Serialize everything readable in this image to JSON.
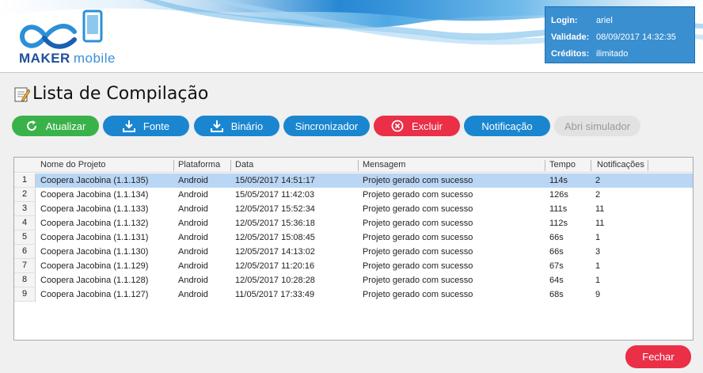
{
  "header": {
    "logo_maker": "MAKER",
    "logo_mobile": "mobile",
    "info": [
      {
        "key": "Login:",
        "value": "ariel"
      },
      {
        "key": "Validade:",
        "value": "08/09/2017 14:32:35"
      },
      {
        "key": "Créditos:",
        "value": "ilimitado"
      }
    ]
  },
  "page": {
    "title": "Lista de Compilação"
  },
  "toolbar": {
    "atualizar": "Atualizar",
    "fonte": "Fonte",
    "binario": "Binário",
    "sincronizador": "Sincronizador",
    "excluir": "Excluir",
    "notificacao": "Notificação",
    "abri_simulador": "Abri simulador"
  },
  "table": {
    "columns": [
      "Nome do Projeto",
      "Plataforma",
      "Data",
      "Mensagem",
      "Tempo",
      "Notificações"
    ],
    "rows": [
      {
        "n": "1",
        "nome": "Coopera Jacobina (1.1.135)",
        "plataforma": "Android",
        "data": "15/05/2017 14:51:17",
        "mensagem": "Projeto gerado com sucesso",
        "tempo": "114s",
        "notif": "2"
      },
      {
        "n": "2",
        "nome": "Coopera Jacobina (1.1.134)",
        "plataforma": "Android",
        "data": "15/05/2017 11:42:03",
        "mensagem": "Projeto gerado com sucesso",
        "tempo": "126s",
        "notif": "2"
      },
      {
        "n": "3",
        "nome": "Coopera Jacobina (1.1.133)",
        "plataforma": "Android",
        "data": "12/05/2017 15:52:34",
        "mensagem": "Projeto gerado com sucesso",
        "tempo": "111s",
        "notif": "11"
      },
      {
        "n": "4",
        "nome": "Coopera Jacobina (1.1.132)",
        "plataforma": "Android",
        "data": "12/05/2017 15:36:18",
        "mensagem": "Projeto gerado com sucesso",
        "tempo": "112s",
        "notif": "11"
      },
      {
        "n": "5",
        "nome": "Coopera Jacobina (1.1.131)",
        "plataforma": "Android",
        "data": "12/05/2017 15:08:45",
        "mensagem": "Projeto gerado com sucesso",
        "tempo": "66s",
        "notif": "1"
      },
      {
        "n": "6",
        "nome": "Coopera Jacobina (1.1.130)",
        "plataforma": "Android",
        "data": "12/05/2017 14:13:02",
        "mensagem": "Projeto gerado com sucesso",
        "tempo": "66s",
        "notif": "3"
      },
      {
        "n": "7",
        "nome": "Coopera Jacobina (1.1.129)",
        "plataforma": "Android",
        "data": "12/05/2017 11:20:16",
        "mensagem": "Projeto gerado com sucesso",
        "tempo": "67s",
        "notif": "1"
      },
      {
        "n": "8",
        "nome": "Coopera Jacobina (1.1.128)",
        "plataforma": "Android",
        "data": "12/05/2017 10:28:28",
        "mensagem": "Projeto gerado com sucesso",
        "tempo": "64s",
        "notif": "1"
      },
      {
        "n": "9",
        "nome": "Coopera Jacobina (1.1.127)",
        "plataforma": "Android",
        "data": "11/05/2017 17:33:49",
        "mensagem": "Projeto gerado com sucesso",
        "tempo": "68s",
        "notif": "9"
      }
    ]
  },
  "footer": {
    "fechar": "Fechar"
  },
  "colors": {
    "green": "#3ab24a",
    "blue": "#1a86d0",
    "red": "#ea2f47",
    "selected_row": "#b9d6f5",
    "info_box": "#3a8fd0"
  }
}
